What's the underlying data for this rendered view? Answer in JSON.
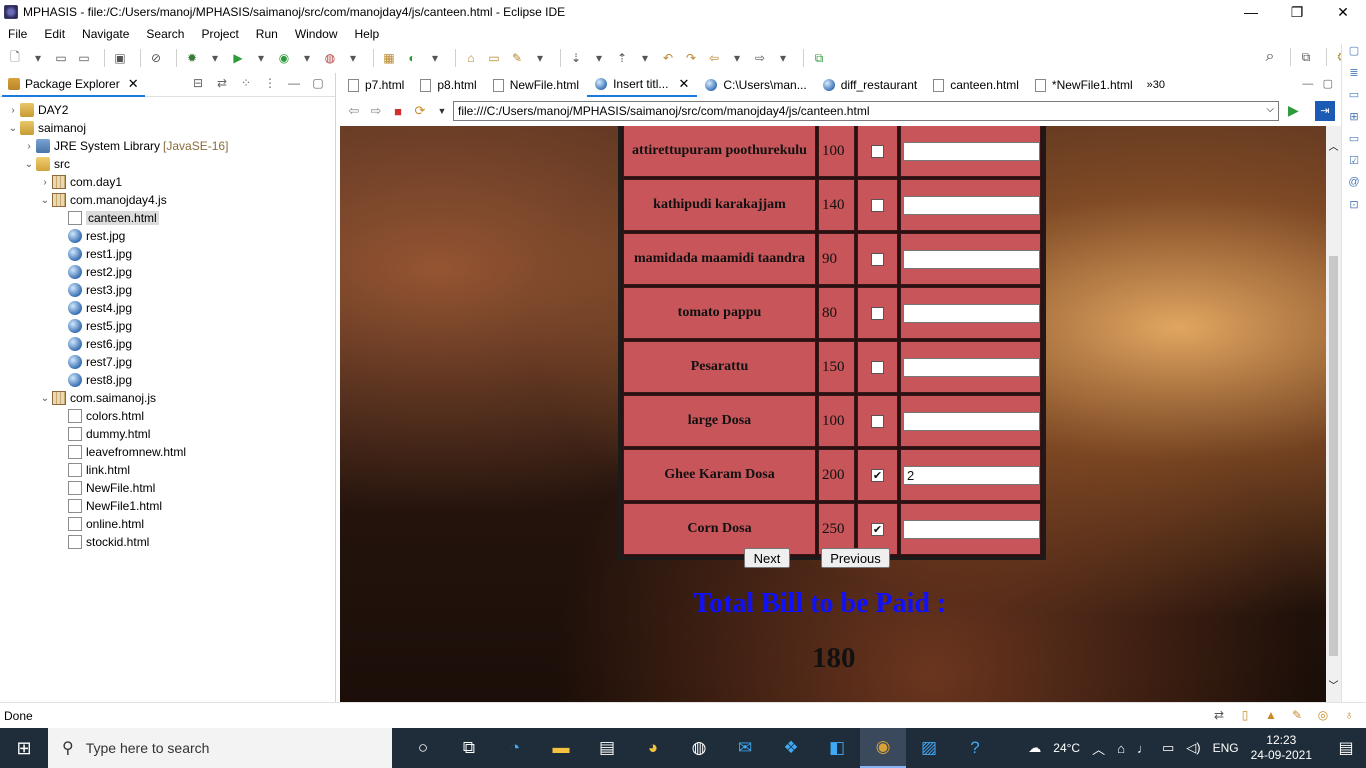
{
  "window": {
    "title": "MPHASIS - file:/C:/Users/manoj/MPHASIS/saimanoj/src/com/manojday4/js/canteen.html - Eclipse IDE",
    "minimize": "—",
    "restore": "❐",
    "close": "✕"
  },
  "menu": [
    "File",
    "Edit",
    "Navigate",
    "Search",
    "Project",
    "Run",
    "Window",
    "Help"
  ],
  "explorer": {
    "tab_label": "Package Explorer",
    "tree": [
      {
        "label": "DAY2",
        "icon": "project-icon",
        "indent": 0,
        "twisty": "›"
      },
      {
        "label": "saimanoj",
        "icon": "project-icon",
        "indent": 0,
        "twisty": "⌄"
      },
      {
        "label": "JRE System Library",
        "extra": "[JavaSE-16]",
        "icon": "library-icon",
        "indent": 1,
        "twisty": "›"
      },
      {
        "label": "src",
        "icon": "source-folder-icon",
        "indent": 1,
        "twisty": "⌄"
      },
      {
        "label": "com.day1",
        "icon": "package-icon",
        "indent": 2,
        "twisty": "›"
      },
      {
        "label": "com.manojday4.js",
        "icon": "package-icon",
        "indent": 2,
        "twisty": "⌄"
      },
      {
        "label": "canteen.html",
        "icon": "html-file-icon",
        "indent": 3,
        "twisty": "",
        "selected": true
      },
      {
        "label": "rest.jpg",
        "icon": "image-file-icon",
        "indent": 3,
        "twisty": ""
      },
      {
        "label": "rest1.jpg",
        "icon": "image-file-icon",
        "indent": 3,
        "twisty": ""
      },
      {
        "label": "rest2.jpg",
        "icon": "image-file-icon",
        "indent": 3,
        "twisty": ""
      },
      {
        "label": "rest3.jpg",
        "icon": "image-file-icon",
        "indent": 3,
        "twisty": ""
      },
      {
        "label": "rest4.jpg",
        "icon": "image-file-icon",
        "indent": 3,
        "twisty": ""
      },
      {
        "label": "rest5.jpg",
        "icon": "image-file-icon",
        "indent": 3,
        "twisty": ""
      },
      {
        "label": "rest6.jpg",
        "icon": "image-file-icon",
        "indent": 3,
        "twisty": ""
      },
      {
        "label": "rest7.jpg",
        "icon": "image-file-icon",
        "indent": 3,
        "twisty": ""
      },
      {
        "label": "rest8.jpg",
        "icon": "image-file-icon",
        "indent": 3,
        "twisty": ""
      },
      {
        "label": "com.saimanoj.js",
        "icon": "package-icon",
        "indent": 2,
        "twisty": "⌄"
      },
      {
        "label": "colors.html",
        "icon": "html-file-icon",
        "indent": 3,
        "twisty": ""
      },
      {
        "label": "dummy.html",
        "icon": "html-file-icon",
        "indent": 3,
        "twisty": ""
      },
      {
        "label": "leavefromnew.html",
        "icon": "html-file-icon",
        "indent": 3,
        "twisty": ""
      },
      {
        "label": "link.html",
        "icon": "html-file-icon",
        "indent": 3,
        "twisty": ""
      },
      {
        "label": "NewFile.html",
        "icon": "html-file-icon",
        "indent": 3,
        "twisty": ""
      },
      {
        "label": "NewFile1.html",
        "icon": "html-file-icon",
        "indent": 3,
        "twisty": ""
      },
      {
        "label": "online.html",
        "icon": "html-file-icon",
        "indent": 3,
        "twisty": ""
      },
      {
        "label": "stockid.html",
        "icon": "html-file-icon",
        "indent": 3,
        "twisty": ""
      }
    ]
  },
  "editor_tabs": [
    {
      "label": "p7.html",
      "icon": "file"
    },
    {
      "label": "p8.html",
      "icon": "file"
    },
    {
      "label": "NewFile.html",
      "icon": "file"
    },
    {
      "label": "Insert titl...",
      "icon": "globe",
      "active": true
    },
    {
      "label": "C:\\Users\\man...",
      "icon": "globe"
    },
    {
      "label": "diff_restaurant",
      "icon": "globe"
    },
    {
      "label": "canteen.html",
      "icon": "file"
    },
    {
      "label": "*NewFile1.html",
      "icon": "file"
    }
  ],
  "editor_overflow": "»30",
  "browser": {
    "url": "file:///C:/Users/manoj/MPHASIS/saimanoj/src/com/manojday4/js/canteen.html"
  },
  "menu_items": [
    {
      "name": "attirettupuram poothurekulu",
      "price": "100",
      "checked": false,
      "qty": ""
    },
    {
      "name": "kathipudi karakajjam",
      "price": "140",
      "checked": false,
      "qty": ""
    },
    {
      "name": "mamidada maamidi taandra",
      "price": "90",
      "checked": false,
      "qty": ""
    },
    {
      "name": "tomato pappu",
      "price": "80",
      "checked": false,
      "qty": ""
    },
    {
      "name": "Pesarattu",
      "price": "150",
      "checked": false,
      "qty": ""
    },
    {
      "name": "large Dosa",
      "price": "100",
      "checked": false,
      "qty": ""
    },
    {
      "name": "Ghee Karam Dosa",
      "price": "200",
      "checked": true,
      "qty": "2"
    },
    {
      "name": "Corn Dosa",
      "price": "250",
      "checked": true,
      "qty": ""
    }
  ],
  "buttons": {
    "next": "Next",
    "previous": "Previous"
  },
  "total": {
    "label": "Total Bill to be Paid :",
    "value": "180"
  },
  "status": {
    "text": "Done"
  },
  "taskbar": {
    "search_placeholder": "Type here to search",
    "weather": "24°C",
    "language": "ENG",
    "time": "12:23",
    "date": "24-09-2021"
  },
  "colors": {
    "table_cell": "#c8555a",
    "total_label": "#1010ff",
    "taskbar": "#1f2d3a",
    "accent": "#1a7ae0"
  }
}
